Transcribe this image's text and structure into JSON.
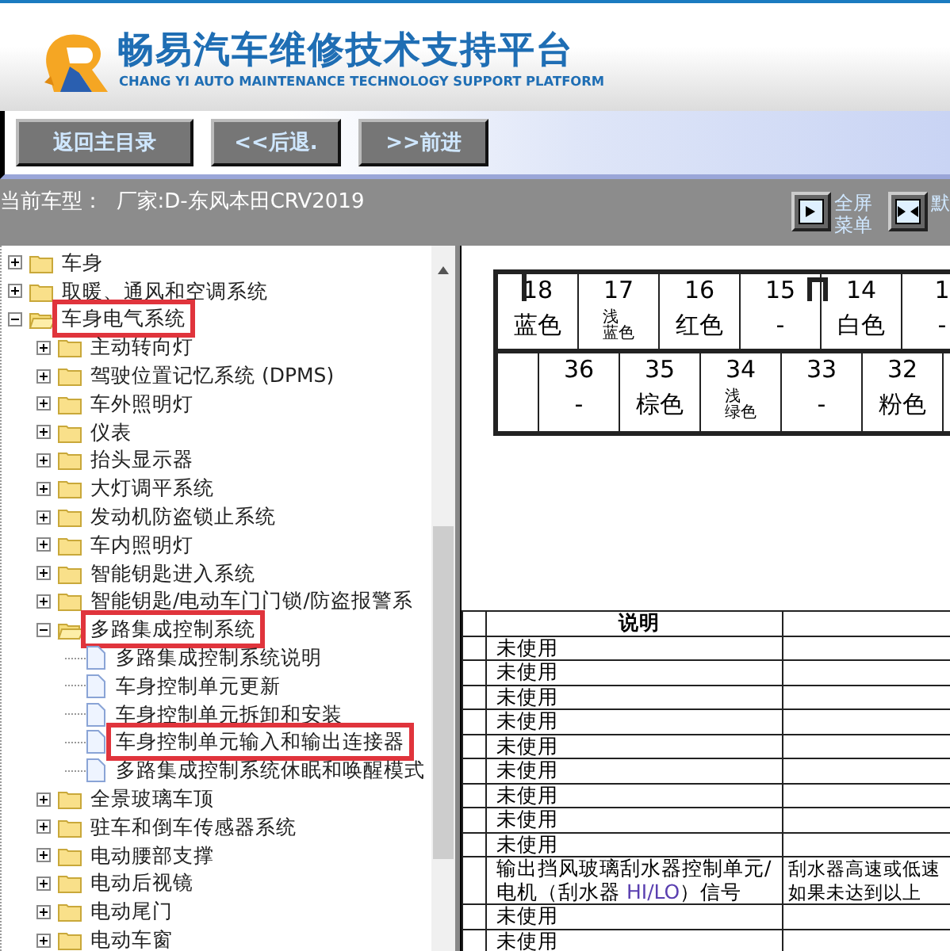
{
  "header": {
    "title": "畅易汽车维修技术支持平台",
    "subtitle": "CHANG YI AUTO MAINTENANCE TECHNOLOGY SUPPORT PLATFORM"
  },
  "nav_buttons": [
    "返回主目录",
    "<<后退.",
    ">>前进"
  ],
  "model_bar": {
    "label": "当前车型：",
    "vehicle": "厂家:D-东风本田CRV2019",
    "tools": [
      {
        "kind": "fullscreen",
        "lines": [
          "全屏",
          "菜单"
        ]
      },
      {
        "kind": "split",
        "lines": [
          "默"
        ]
      }
    ]
  },
  "tree": [
    {
      "kind": "folder",
      "label": "车身",
      "expanded": false,
      "highlighted": false
    },
    {
      "kind": "folder",
      "label": "取暖、通风和空调系统",
      "expanded": false,
      "highlighted": false
    },
    {
      "kind": "folder",
      "label": "车身电气系统",
      "expanded": true,
      "highlighted": true,
      "children": [
        {
          "kind": "folder",
          "label": "主动转向灯",
          "expanded": false,
          "highlighted": false
        },
        {
          "kind": "folder",
          "label": "驾驶位置记忆系统 (DPMS)",
          "expanded": false,
          "highlighted": false
        },
        {
          "kind": "folder",
          "label": "车外照明灯",
          "expanded": false,
          "highlighted": false
        },
        {
          "kind": "folder",
          "label": "仪表",
          "expanded": false,
          "highlighted": false
        },
        {
          "kind": "folder",
          "label": "抬头显示器",
          "expanded": false,
          "highlighted": false
        },
        {
          "kind": "folder",
          "label": "大灯调平系统",
          "expanded": false,
          "highlighted": false
        },
        {
          "kind": "folder",
          "label": "发动机防盗锁止系统",
          "expanded": false,
          "highlighted": false
        },
        {
          "kind": "folder",
          "label": "车内照明灯",
          "expanded": false,
          "highlighted": false
        },
        {
          "kind": "folder",
          "label": "智能钥匙进入系统",
          "expanded": false,
          "highlighted": false
        },
        {
          "kind": "folder",
          "label": "智能钥匙/电动车门门锁/防盗报警系",
          "expanded": false,
          "highlighted": false
        },
        {
          "kind": "folder",
          "label": "多路集成控制系统",
          "expanded": true,
          "highlighted": true,
          "children": [
            {
              "kind": "doc",
              "label": "多路集成控制系统说明",
              "highlighted": false
            },
            {
              "kind": "doc",
              "label": "车身控制单元更新",
              "highlighted": false
            },
            {
              "kind": "doc",
              "label": "车身控制单元拆卸和安装",
              "highlighted": false
            },
            {
              "kind": "doc",
              "label": "车身控制单元输入和输出连接器",
              "highlighted": true
            },
            {
              "kind": "doc",
              "label": "多路集成控制系统休眠和唤醒模式",
              "highlighted": false
            }
          ]
        },
        {
          "kind": "folder",
          "label": "全景玻璃车顶",
          "expanded": false,
          "highlighted": false
        },
        {
          "kind": "folder",
          "label": "驻车和倒车传感器系统",
          "expanded": false,
          "highlighted": false
        },
        {
          "kind": "folder",
          "label": "电动腰部支撑",
          "expanded": false,
          "highlighted": false
        },
        {
          "kind": "folder",
          "label": "电动后视镜",
          "expanded": false,
          "highlighted": false
        },
        {
          "kind": "folder",
          "label": "电动尾门",
          "expanded": false,
          "highlighted": false
        },
        {
          "kind": "folder",
          "label": "电动车窗",
          "expanded": false,
          "highlighted": false
        }
      ]
    }
  ],
  "connector": {
    "top_row": [
      {
        "pin": "18",
        "wire": "蓝色"
      },
      {
        "pin": "17",
        "wire": "浅蓝色"
      },
      {
        "pin": "16",
        "wire": "红色"
      },
      {
        "pin": "15",
        "wire": "-"
      },
      {
        "pin": "14",
        "wire": "白色"
      },
      {
        "pin": "1",
        "wire": "-"
      }
    ],
    "bottom_row": [
      {
        "pin": "36",
        "wire": "-"
      },
      {
        "pin": "35",
        "wire": "棕色"
      },
      {
        "pin": "34",
        "wire": "浅绿色"
      },
      {
        "pin": "33",
        "wire": "-"
      },
      {
        "pin": "32",
        "wire": "粉色"
      }
    ]
  },
  "table": {
    "header": "说明",
    "rows": [
      {
        "description": [
          {
            "text": "未使用"
          }
        ]
      },
      {
        "description": [
          {
            "text": "未使用"
          }
        ]
      },
      {
        "description": [
          {
            "text": "未使用"
          }
        ]
      },
      {
        "description": [
          {
            "text": "未使用"
          }
        ]
      },
      {
        "description": [
          {
            "text": "未使用"
          }
        ]
      },
      {
        "description": [
          {
            "text": "未使用"
          }
        ]
      },
      {
        "description": [
          {
            "text": "未使用"
          }
        ]
      },
      {
        "description": [
          {
            "text": "未使用"
          }
        ]
      },
      {
        "description": [
          {
            "text": "未使用"
          }
        ]
      },
      {
        "description": [
          {
            "text": "输出挡风玻璃刮水器控制单元/电机（刮水器 "
          },
          {
            "text": "HI/LO",
            "kind": "signal"
          },
          {
            "text": "）信号"
          }
        ],
        "column_3": [
          "刮水器高速或低速",
          "如果未达到以上"
        ]
      },
      {
        "description": [
          {
            "text": "未使用"
          }
        ]
      },
      {
        "description": [
          {
            "text": "未使用"
          }
        ]
      }
    ]
  }
}
